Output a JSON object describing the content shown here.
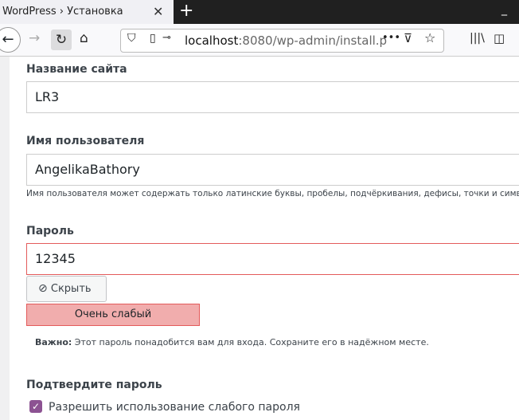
{
  "browser": {
    "tab_title": "WordPress › Установка",
    "url_host": "localhost",
    "url_rest": ":8080/wp-admin/install.p"
  },
  "form": {
    "site_title_label": "Название сайта",
    "site_title_value": "LR3",
    "username_label": "Имя пользователя",
    "username_value": "AngelikaBathory",
    "username_hint": "Имя пользователя может содержать только латинские буквы, пробелы, подчёркивания, дефисы, точки и символ @",
    "password_label": "Пароль",
    "password_value": "12345",
    "hide_button": "Скрыть",
    "strength": "Очень слабый",
    "important_bold": "Важно:",
    "important_text": " Этот пароль понадобится вам для входа. Сохраните его в надёжном месте.",
    "confirm_label": "Подтвердите пароль",
    "weak_checkbox_label": "Разрешить использование слабого пароля",
    "weak_checkbox_checked": true
  },
  "colors": {
    "accent": "#8c5292",
    "strength_bg": "#f1adad",
    "error_border": "#e35b5b"
  }
}
